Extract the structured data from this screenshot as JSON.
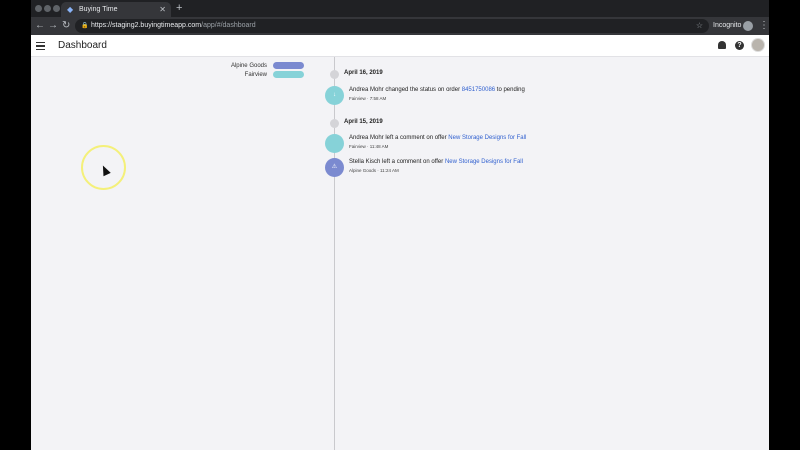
{
  "browser": {
    "tab_title": "Buying Time",
    "url_host": "https://staging2.buyingtimeapp.com",
    "url_path": "/app/#/dashboard",
    "incognito_label": "Incognito"
  },
  "appbar": {
    "title": "Dashboard"
  },
  "legend": [
    {
      "label": "Alpine Goods",
      "color": "#7b8ad0"
    },
    {
      "label": "Fairview",
      "color": "#86d2d8"
    }
  ],
  "timeline": [
    {
      "date": "April 16, 2019",
      "events": [
        {
          "circle_text": "↓",
          "circle_color": "#86d2d8",
          "text_before": "Andrea Mohr changed the status on order ",
          "link": "8451750086",
          "text_after": " to pending",
          "meta": "Fairview · 7:58 AM"
        }
      ]
    },
    {
      "date": "April 15, 2019",
      "events": [
        {
          "circle_text": "",
          "circle_color": "#86d2d8",
          "text_before": "Andrea Mohr left a comment on offer ",
          "link": "New Storage Designs for Fall",
          "text_after": "",
          "meta": "Fairview · 11:48 AM"
        },
        {
          "circle_text": "⚠",
          "circle_color": "#7b8ad0",
          "text_before": "Stella Kisch left a comment on offer ",
          "link": "New Storage Designs for Fall",
          "text_after": "",
          "meta": "Alpine Goods · 11:24 AM"
        }
      ]
    }
  ],
  "icons": {
    "tab_close": "✕",
    "new_tab": "+",
    "back": "←",
    "forward": "→",
    "reload": "↻",
    "lock": "🔒",
    "star": "☆",
    "more": "⋮",
    "help": "?"
  }
}
